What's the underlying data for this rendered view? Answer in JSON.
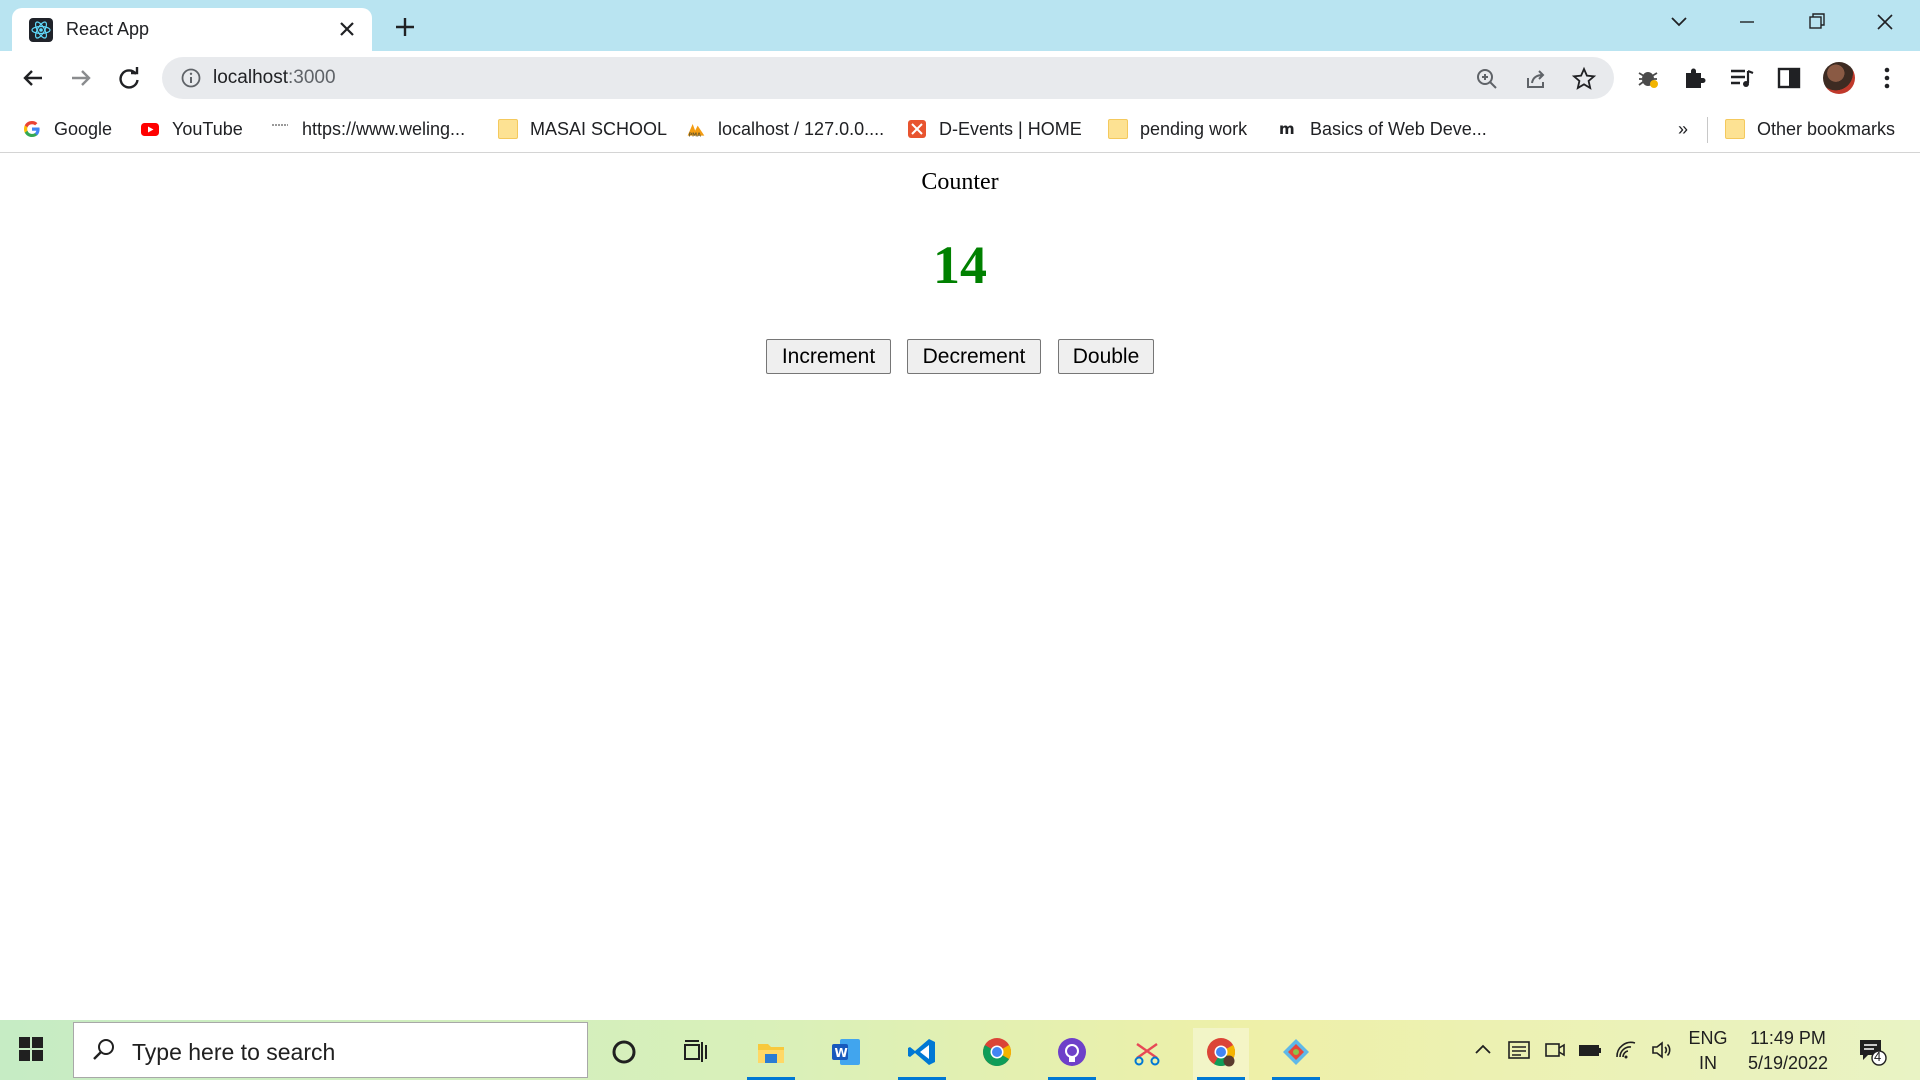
{
  "browser": {
    "tab": {
      "title": "React App"
    },
    "url": {
      "host": "localhost",
      "port": ":3000"
    },
    "bookmarks": [
      {
        "label": "Google",
        "icon": "google-icon"
      },
      {
        "label": "YouTube",
        "icon": "youtube-icon"
      },
      {
        "label": "https://www.weling...",
        "icon": "site-icon"
      },
      {
        "label": "MASAI SCHOOL",
        "icon": "folder-icon"
      },
      {
        "label": "localhost / 127.0.0....",
        "icon": "phpmyadmin-icon"
      },
      {
        "label": "D-Events | HOME",
        "icon": "devents-icon"
      },
      {
        "label": "pending work",
        "icon": "folder-icon"
      },
      {
        "label": "Basics of Web Deve...",
        "icon": "medium-icon"
      }
    ],
    "more_bookmarks": "»",
    "other_bookmarks": "Other bookmarks"
  },
  "page": {
    "title": "Counter",
    "count": "14",
    "count_color": "#008000",
    "buttons": {
      "increment": "Increment",
      "decrement": "Decrement",
      "double": "Double"
    }
  },
  "taskbar": {
    "search_placeholder": "Type here to search",
    "language": {
      "line1": "ENG",
      "line2": "IN"
    },
    "time": "11:49 PM",
    "date": "5/19/2022",
    "notification_count": "4"
  }
}
